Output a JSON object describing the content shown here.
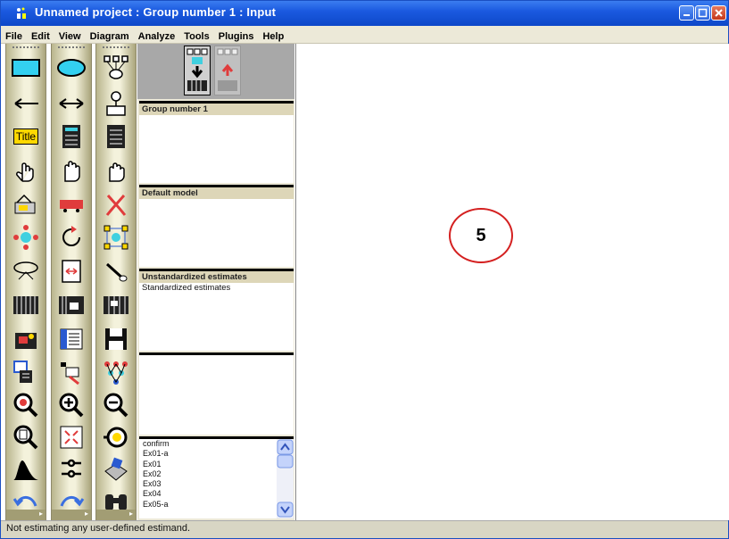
{
  "window": {
    "title": "Unnamed project : Group number 1 : Input"
  },
  "menu": [
    "File",
    "Edit",
    "View",
    "Diagram",
    "Analyze",
    "Tools",
    "Plugins",
    "Help"
  ],
  "toolbox": {
    "title_tool_label": "Title"
  },
  "panels": {
    "groups": {
      "header": "Group number 1"
    },
    "models": {
      "header": "Default model"
    },
    "estimates": {
      "header": "Unstandardized estimates",
      "line2": "Standardized estimates"
    }
  },
  "file_list": [
    "confirm",
    "Ex01-a",
    "Ex01",
    "Ex02",
    "Ex03",
    "Ex04",
    "Ex05-a"
  ],
  "canvas": {
    "marker_label": "5",
    "marker_color": "#d42020"
  },
  "status": {
    "text": "Not estimating any user-defined estimand."
  },
  "colors": {
    "titlebar": "#1b5ae0",
    "menubar": "#ece9d8",
    "panel_header": "#ddd6b8",
    "toolbox": "#f4f2dc"
  }
}
